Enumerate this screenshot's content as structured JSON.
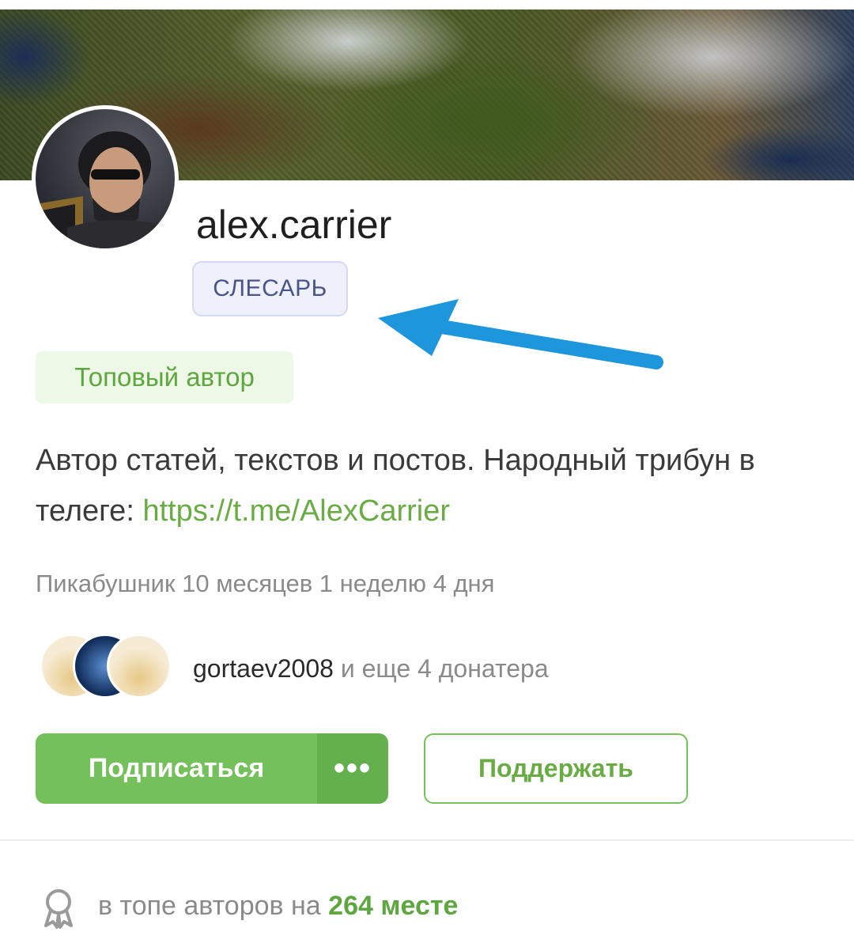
{
  "profile": {
    "username": "alex.carrier",
    "rank": "СЛЕСАРЬ",
    "top_badge": "Топовый автор",
    "bio_text": "Автор статей, текстов и постов. Народный трибун в телеге: ",
    "bio_link": "https://t.me/AlexCarrier",
    "member_since": "Пикабушник 10 месяцев 1 неделю 4 дня"
  },
  "donors": {
    "name": "gortaev2008",
    "rest": " и еще 4 донатера"
  },
  "actions": {
    "subscribe_label": "Подписаться",
    "more_label": "•••",
    "support_label": "Поддержать"
  },
  "ranking": {
    "prefix": "в топе авторов на ",
    "place": "264 месте"
  },
  "colors": {
    "accent_green": "#74c05b",
    "link_green": "#6aac44",
    "rank_text": "#4a5488",
    "arrow_blue": "#1e96dc"
  }
}
